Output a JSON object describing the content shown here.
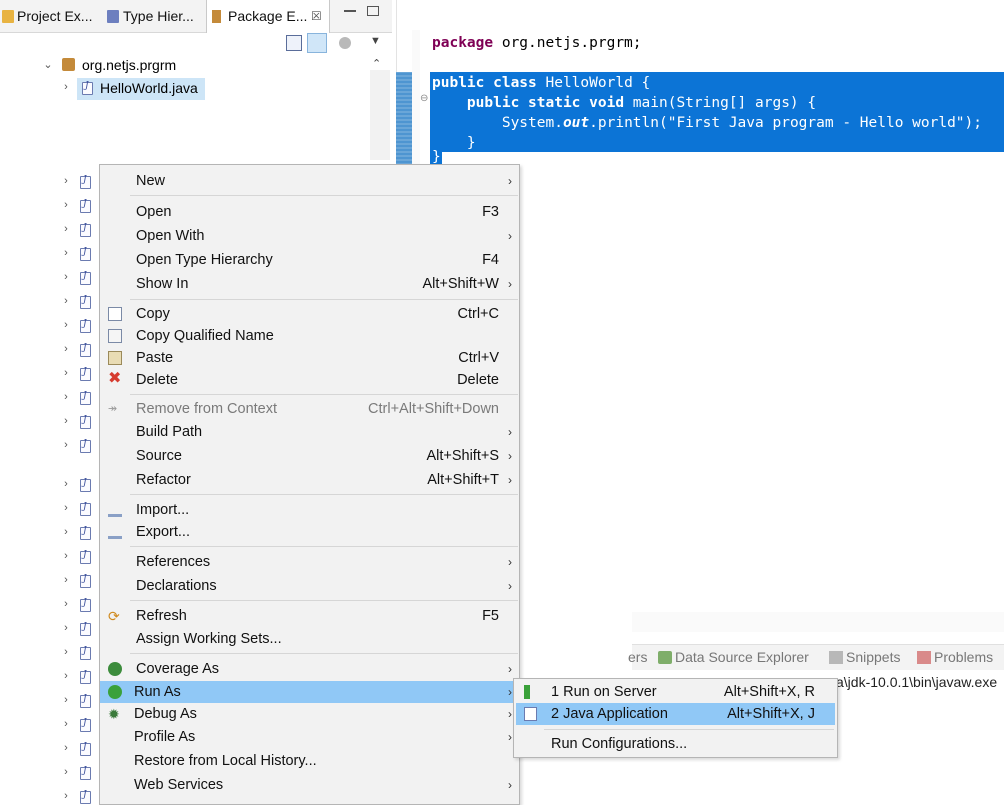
{
  "tabs": [
    {
      "label": "Project Ex...",
      "icon": "project-explorer-icon",
      "active": false
    },
    {
      "label": "Type Hier...",
      "icon": "type-hierarchy-icon",
      "active": false
    },
    {
      "label": "Package E...",
      "icon": "package-explorer-icon",
      "active": true
    }
  ],
  "tab_close": "☒",
  "tree": {
    "package": "org.netjs.prgrm",
    "file": "HelloWorld.java"
  },
  "editor": {
    "line1_kw": "package",
    "line1_rest": " org.netjs.prgrm;",
    "line2_kw": "public class",
    "line2_rest": " HelloWorld {",
    "line3_kw": "    public static void",
    "line3_rest": " main(String[] args) {",
    "line4_a": "        System.",
    "line4_b": "out",
    "line4_c": ".println(\"First Java program - Hello world\");",
    "line5": "    }",
    "line6": "}"
  },
  "context_menu": {
    "items": [
      {
        "label": "New",
        "shortcut": "",
        "submenu": true
      },
      {
        "label": "Open",
        "shortcut": "F3",
        "submenu": false
      },
      {
        "label": "Open With",
        "shortcut": "",
        "submenu": true
      },
      {
        "label": "Open Type Hierarchy",
        "shortcut": "F4",
        "submenu": false
      },
      {
        "label": "Show In",
        "shortcut": "Alt+Shift+W",
        "submenu": true
      },
      {
        "label": "Copy",
        "shortcut": "Ctrl+C",
        "submenu": false
      },
      {
        "label": "Copy Qualified Name",
        "shortcut": "",
        "submenu": false
      },
      {
        "label": "Paste",
        "shortcut": "Ctrl+V",
        "submenu": false
      },
      {
        "label": "Delete",
        "shortcut": "Delete",
        "submenu": false
      },
      {
        "label": "Remove from Context",
        "shortcut": "Ctrl+Alt+Shift+Down",
        "submenu": false
      },
      {
        "label": "Build Path",
        "shortcut": "",
        "submenu": true
      },
      {
        "label": "Source",
        "shortcut": "Alt+Shift+S",
        "submenu": true
      },
      {
        "label": "Refactor",
        "shortcut": "Alt+Shift+T",
        "submenu": true
      },
      {
        "label": "Import...",
        "shortcut": "",
        "submenu": false
      },
      {
        "label": "Export...",
        "shortcut": "",
        "submenu": false
      },
      {
        "label": "References",
        "shortcut": "",
        "submenu": true
      },
      {
        "label": "Declarations",
        "shortcut": "",
        "submenu": true
      },
      {
        "label": "Refresh",
        "shortcut": "F5",
        "submenu": false
      },
      {
        "label": "Assign Working Sets...",
        "shortcut": "",
        "submenu": false
      },
      {
        "label": "Coverage As",
        "shortcut": "",
        "submenu": true
      },
      {
        "label": "Run As",
        "shortcut": "",
        "submenu": true
      },
      {
        "label": "Debug As",
        "shortcut": "",
        "submenu": true
      },
      {
        "label": "Profile As",
        "shortcut": "",
        "submenu": true
      },
      {
        "label": "Restore from Local History...",
        "shortcut": "",
        "submenu": false
      },
      {
        "label": "Web Services",
        "shortcut": "",
        "submenu": true
      }
    ],
    "arrow": "›"
  },
  "run_as_submenu": {
    "items": [
      {
        "label": "1 Run on Server",
        "shortcut": "Alt+Shift+X, R"
      },
      {
        "label": "2 Java Application",
        "shortcut": "Alt+Shift+X, J"
      },
      {
        "label": "Run Configurations...",
        "shortcut": ""
      }
    ]
  },
  "bottom_panel": {
    "tabs": [
      {
        "label": "ers"
      },
      {
        "label": "Data Source Explorer"
      },
      {
        "label": "Snippets"
      },
      {
        "label": "Problems"
      }
    ],
    "console_text": "a\\jdk-10.0.1\\bin\\javaw.exe"
  },
  "colors": {
    "selection": "#0c74d6",
    "menu_highlight": "#90c8f6",
    "keyword": "#7f0055"
  }
}
